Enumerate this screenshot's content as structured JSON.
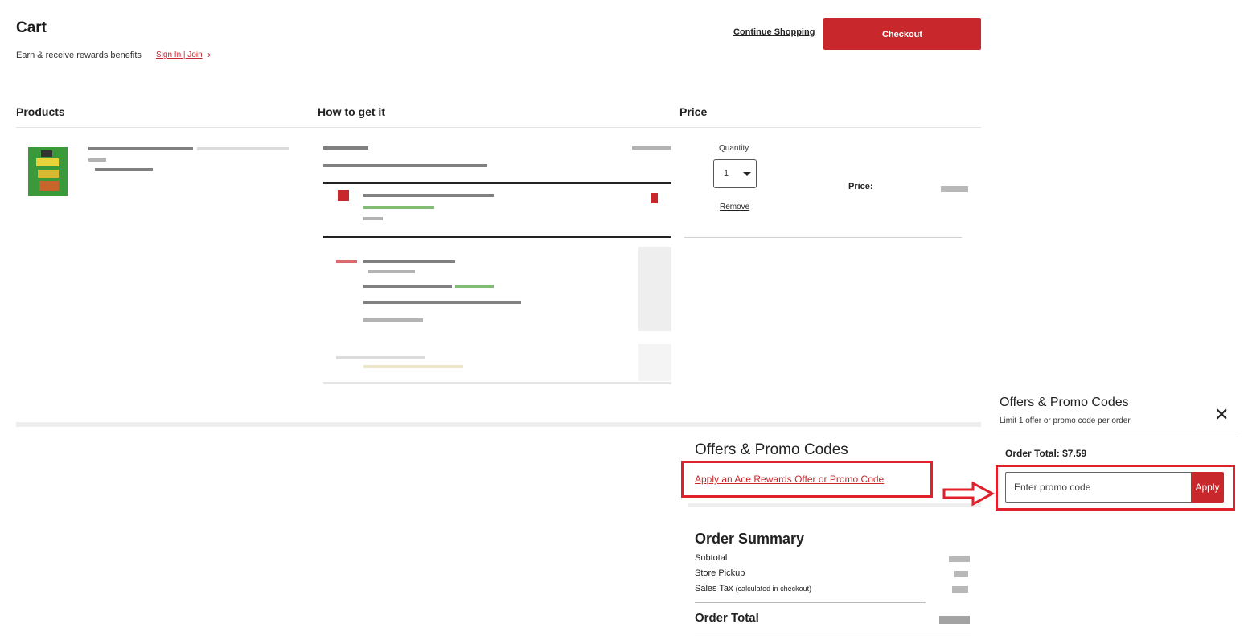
{
  "header": {
    "title": "Cart",
    "rewards_text": "Earn & receive rewards benefits",
    "signin_label": "Sign In | Join",
    "chevron": "›",
    "continue_label": "Continue Shopping",
    "checkout_label": "Checkout"
  },
  "table": {
    "columns": [
      "Products",
      "How to get it",
      "Price"
    ]
  },
  "item": {
    "quantity_label": "Quantity",
    "quantity_value": "1",
    "remove_label": "Remove",
    "price_label": "Price:"
  },
  "offers": {
    "title": "Offers & Promo Codes",
    "apply_link": "Apply an Ace Rewards Offer or Promo Code"
  },
  "summary": {
    "title": "Order Summary",
    "subtotal_label": "Subtotal",
    "pickup_label": "Store Pickup",
    "tax_label": "Sales Tax",
    "tax_note": "(calculated in checkout)",
    "total_label": "Order Total"
  },
  "panel": {
    "title": "Offers & Promo Codes",
    "subtitle": "Limit 1 offer or promo code per order.",
    "close_icon": "✕",
    "order_total": "Order Total: $7.59",
    "promo_placeholder": "Enter promo code",
    "apply_label": "Apply"
  },
  "colors": {
    "brand_red": "#c8282c",
    "highlight_red": "#e0202a"
  }
}
